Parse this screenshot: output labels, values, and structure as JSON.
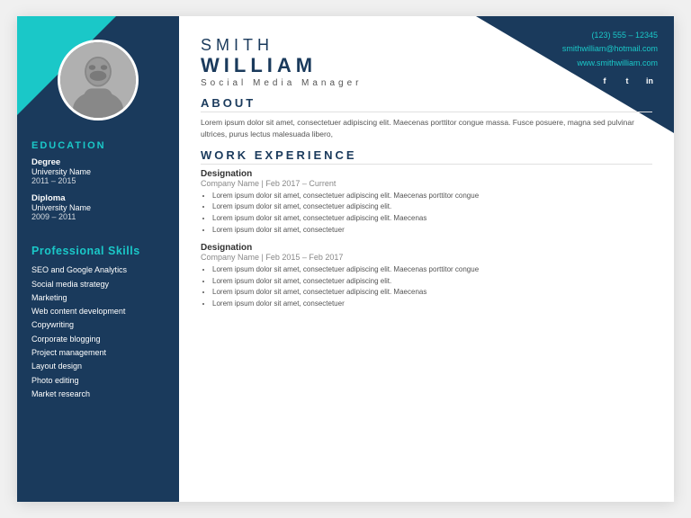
{
  "sidebar": {
    "education_title": "EDUCATION",
    "edu_items": [
      {
        "label": "Degree",
        "name": "University Name",
        "year": "2011 – 2015"
      },
      {
        "label": "Diploma",
        "name": "University Name",
        "year": "2009 – 2011"
      }
    ],
    "skills_title": "Professional Skills",
    "skills": [
      "SEO and Google Analytics",
      "Social media strategy",
      "Marketing",
      "Web content development",
      "Copywriting",
      "Corporate blogging",
      "Project management",
      "Layout design",
      "Photo editing",
      "Market research"
    ]
  },
  "header": {
    "first_name": "SMITH",
    "last_name": "WILLIAM",
    "job_title": "Social  Media  Manager"
  },
  "contact": {
    "phone": "(123) 555 – 12345",
    "email": "smithwilliam@hotmail.com",
    "website": "www.smithwilliam.com"
  },
  "about": {
    "title": "ABOUT",
    "text": "Lorem ipsum dolor sit amet, consectetuer adipiscing elit. Maecenas porttitor congue massa. Fusce posuere, magna sed pulvinar ultrices, purus lectus malesuada libero,"
  },
  "work_experience": {
    "title": "WORK EXPERIENCE",
    "jobs": [
      {
        "designation": "Designation",
        "company": "Company Name | Feb 2017 – Current",
        "bullets": [
          "Lorem ipsum dolor sit amet, consectetuer adipiscing elit. Maecenas porttitor congue",
          "Lorem ipsum dolor sit amet, consectetuer adipiscing elit.",
          "Lorem ipsum dolor sit amet, consectetuer adipiscing elit. Maecenas",
          "Lorem ipsum dolor sit amet, consectetuer"
        ]
      },
      {
        "designation": "Designation",
        "company": "Company Name | Feb 2015 – Feb 2017",
        "bullets": [
          "Lorem ipsum dolor sit amet, consectetuer adipiscing elit. Maecenas porttitor congue",
          "Lorem ipsum dolor sit amet, consectetuer adipiscing elit.",
          "Lorem ipsum dolor sit amet, consectetuer adipiscing elit. Maecenas",
          "Lorem ipsum dolor sit amet, consectetuer"
        ]
      }
    ]
  },
  "social": [
    {
      "label": "f"
    },
    {
      "label": "t"
    },
    {
      "label": "in"
    }
  ]
}
